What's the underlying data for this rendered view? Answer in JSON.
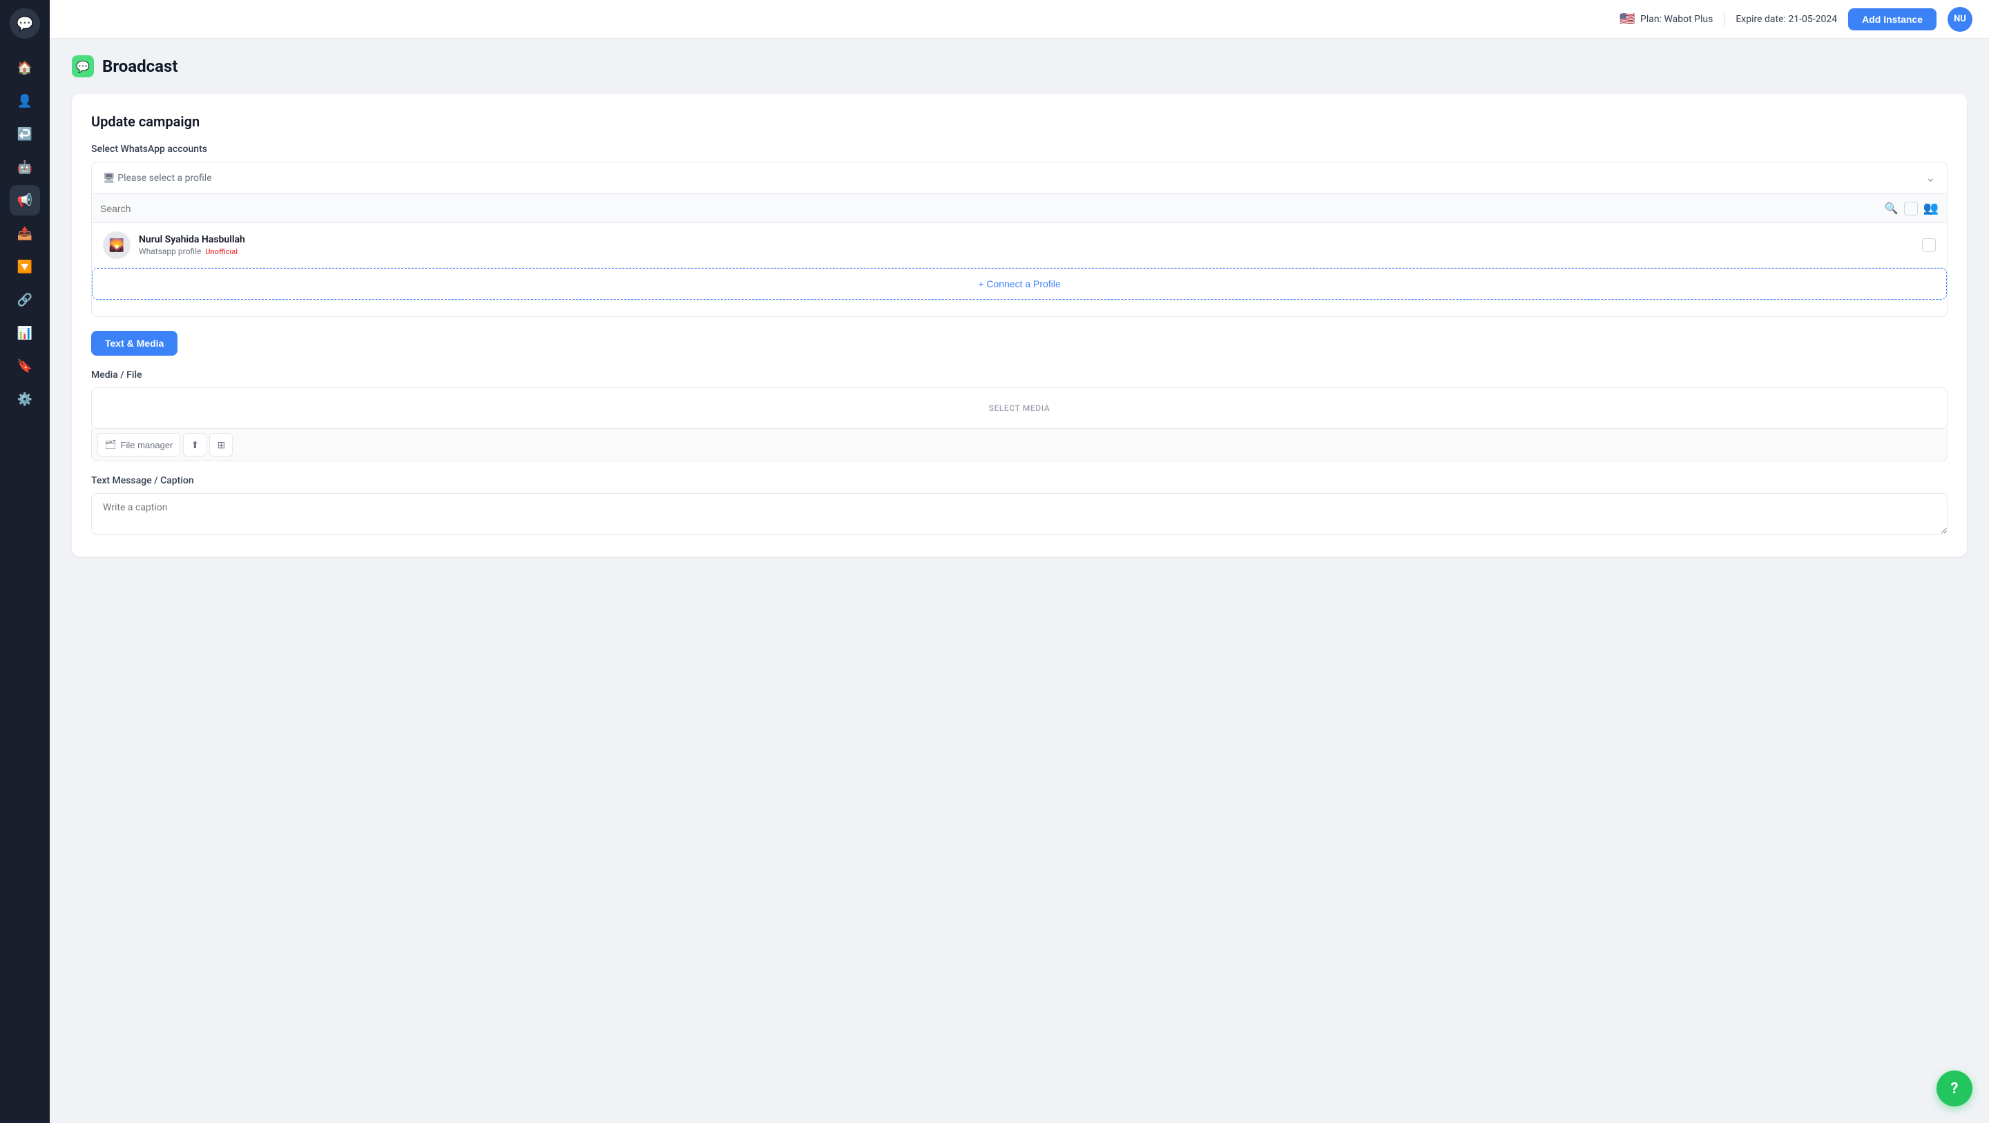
{
  "sidebar": {
    "logo_icon": "💬",
    "items": [
      {
        "id": "home",
        "icon": "🏠",
        "active": false
      },
      {
        "id": "contacts",
        "icon": "👤",
        "active": false
      },
      {
        "id": "reply",
        "icon": "↩️",
        "active": false
      },
      {
        "id": "bot",
        "icon": "🤖",
        "active": false
      },
      {
        "id": "broadcast",
        "icon": "📢",
        "active": true
      },
      {
        "id": "export",
        "icon": "📤",
        "active": false
      },
      {
        "id": "filter",
        "icon": "🔽",
        "active": false
      },
      {
        "id": "network",
        "icon": "🔗",
        "active": false
      },
      {
        "id": "analytics",
        "icon": "📊",
        "active": false
      },
      {
        "id": "marker",
        "icon": "🔖",
        "active": false
      },
      {
        "id": "settings",
        "icon": "⚙️",
        "active": false
      }
    ]
  },
  "header": {
    "flag_emoji": "🇺🇸",
    "plan_label": "Plan: Wabot Plus",
    "separator": "|",
    "expire_label": "Expire date: 21-05-2024",
    "add_instance_label": "Add Instance",
    "avatar_initials": "NU"
  },
  "page": {
    "icon": "💬",
    "title": "Broadcast",
    "campaign_title": "Update campaign"
  },
  "whatsapp_section": {
    "label": "Select WhatsApp accounts",
    "placeholder": "🖥 Please select a profile",
    "search_placeholder": "Search",
    "profiles": [
      {
        "id": "nurul",
        "name": "Nurul Syahida Hasbullah",
        "type_label": "Whatsapp profile",
        "badge": "Unofficial",
        "avatar_emoji": "🌄"
      }
    ],
    "connect_label": "+ Connect a Profile"
  },
  "tabs": [
    {
      "id": "text-media",
      "label": "Text & Media",
      "active": true
    },
    {
      "id": "other",
      "label": "",
      "active": false
    }
  ],
  "media_section": {
    "label": "Media / File",
    "select_media_label": "SELECT MEDIA",
    "file_manager_label": "File manager",
    "upload_icon": "⬆",
    "grid_icon": "⊞"
  },
  "caption_section": {
    "label": "Text Message / Caption",
    "placeholder": "Write a caption"
  },
  "help": {
    "icon": "?"
  }
}
